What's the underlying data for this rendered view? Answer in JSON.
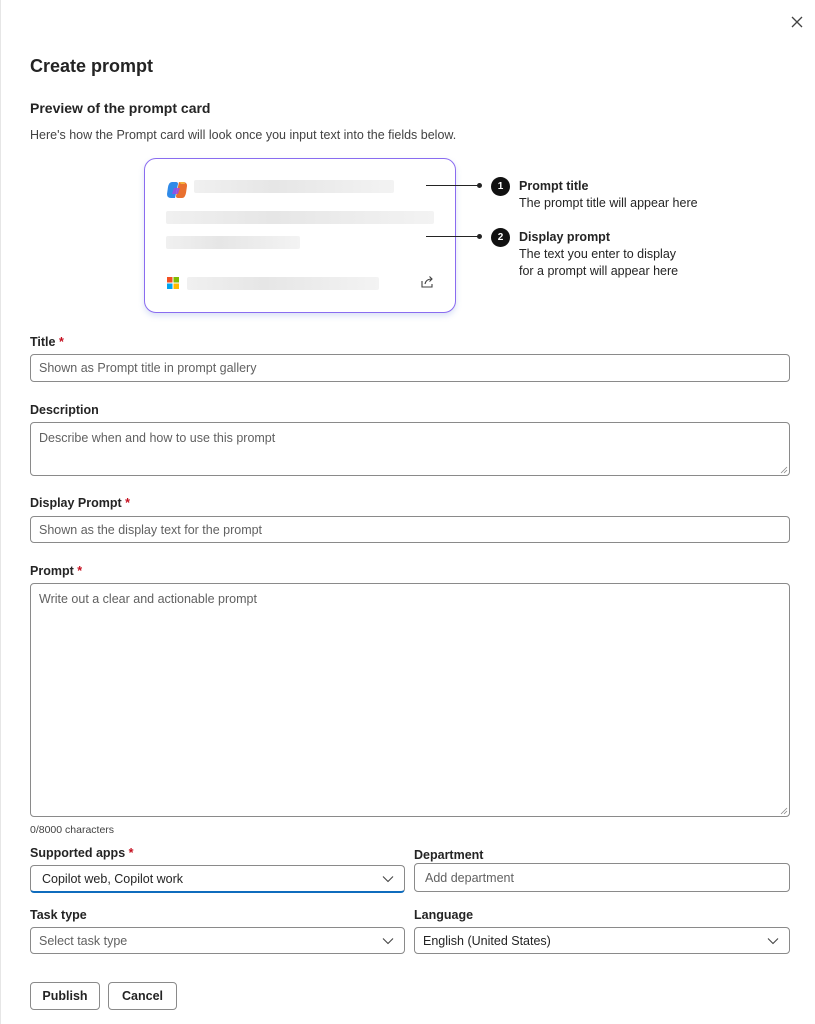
{
  "dialog": {
    "title": "Create prompt",
    "close_icon": "close-icon"
  },
  "preview": {
    "heading": "Preview of the prompt card",
    "helper": "Here's how the Prompt card will look once you input text into the fields below.",
    "callouts": [
      {
        "number": "1",
        "title": "Prompt title",
        "text": "The prompt title will appear here"
      },
      {
        "number": "2",
        "title": "Display prompt",
        "text_line1": "The text you enter to display",
        "text_line2": "for a prompt will appear here"
      }
    ]
  },
  "form": {
    "title": {
      "label": "Title",
      "required_mark": "*",
      "placeholder": "Shown as Prompt title in prompt gallery"
    },
    "description": {
      "label": "Description",
      "placeholder": "Describe when and how to use this prompt"
    },
    "display_prompt": {
      "label": "Display Prompt",
      "required_mark": "*",
      "placeholder": "Shown as the display text for the prompt"
    },
    "prompt": {
      "label": "Prompt",
      "required_mark": "*",
      "placeholder": "Write out a clear and actionable prompt",
      "counter": "0/8000 characters"
    },
    "supported_apps": {
      "label": "Supported apps",
      "required_mark": "*",
      "value": "Copilot web, Copilot work"
    },
    "department": {
      "label": "Department",
      "placeholder": "Add department"
    },
    "task_type": {
      "label": "Task type",
      "placeholder": "Select task type"
    },
    "language": {
      "label": "Language",
      "value": "English (United States)"
    }
  },
  "actions": {
    "publish": "Publish",
    "cancel": "Cancel"
  }
}
